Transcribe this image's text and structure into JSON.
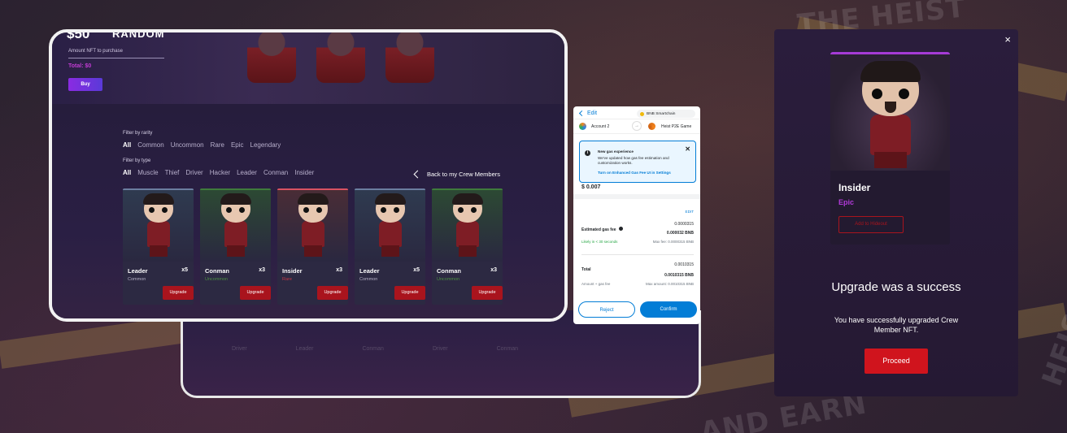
{
  "background": {
    "texts": [
      "THE HEIST",
      "AND EARN",
      "HEIS"
    ]
  },
  "tablet": {
    "price": "$50",
    "random": "RANDOM",
    "amount_label": "Amount NFT to purchase",
    "total": "Total: $0",
    "buy": "Buy",
    "filter_rarity_label": "Filter by rarity",
    "rarities": [
      "All",
      "Common",
      "Uncommon",
      "Rare",
      "Epic",
      "Legendary"
    ],
    "filter_type_label": "Filter by type",
    "types": [
      "All",
      "Muscle",
      "Thief",
      "Driver",
      "Hacker",
      "Leader",
      "Conman",
      "Insider"
    ],
    "back_link": "Back to my Crew Members",
    "cards": [
      {
        "name": "Leader",
        "count": "x5",
        "rarity": "Common",
        "rarity_color": "#b5b0c6",
        "bg": "#2f3b50",
        "line": "#6b7ea0",
        "upgrade": "Upgrade"
      },
      {
        "name": "Conman",
        "count": "x3",
        "rarity": "Uncommon",
        "rarity_color": "#4c8f43",
        "bg": "#2c4a33",
        "line": "#3f7b3c",
        "upgrade": "Upgrade"
      },
      {
        "name": "Insider",
        "count": "x3",
        "rarity": "Rare",
        "rarity_color": "#c43a47",
        "bg": "#4a2d36",
        "line": "#d85262",
        "upgrade": "Upgrade"
      },
      {
        "name": "Leader",
        "count": "x5",
        "rarity": "Common",
        "rarity_color": "#b5b0c6",
        "bg": "#2f3b50",
        "line": "#6b7ea0",
        "upgrade": "Upgrade"
      },
      {
        "name": "Conman",
        "count": "x3",
        "rarity": "Uncommon",
        "rarity_color": "#4c8f43",
        "bg": "#2c4a33",
        "line": "#3f7b3c",
        "upgrade": "Upgrade"
      }
    ]
  },
  "tablet2": {
    "ghost": [
      "Driver",
      "Leader",
      "Conman",
      "Driver",
      "Conman"
    ]
  },
  "wallet": {
    "edit": "Edit",
    "network": "BNB Smartchain",
    "account_from": "Account 2",
    "account_to": "Heist P2E Game",
    "notice_title": "New gas experience",
    "notice_text": "We've updated how gas fee estimation and customization works.",
    "notice_link": "Turn on Enhanced Gas Fee UI in Settings",
    "edit_small": "EDIT",
    "gas_label": "Estimated gas fee",
    "gas_value": "0.0000315",
    "gas_bnb": "0.000032 BNB",
    "likely": "Likely in < 30 seconds",
    "max_fee": "Max fee: 0.0000315 BNB",
    "total_label": "Total",
    "total_value": "0.0010315",
    "total_bnb": "0.0010315 BNB",
    "amount_gas": "Amount + gas fee",
    "max_amount": "Max amount: 0.0010315 BNB",
    "reject": "Reject",
    "confirm": "Confirm"
  },
  "modal": {
    "close": "×",
    "nft_name": "Insider",
    "nft_rarity": "Epic",
    "hideout": "Add to Hideout",
    "success_title": "Upgrade was a success",
    "success_text": "You have successfully upgraded Crew Member NFT.",
    "proceed": "Proceed"
  },
  "colors": {
    "accent_red": "#d0141d",
    "accent_purple": "#a53bd6",
    "wallet_blue": "#037dd6"
  }
}
